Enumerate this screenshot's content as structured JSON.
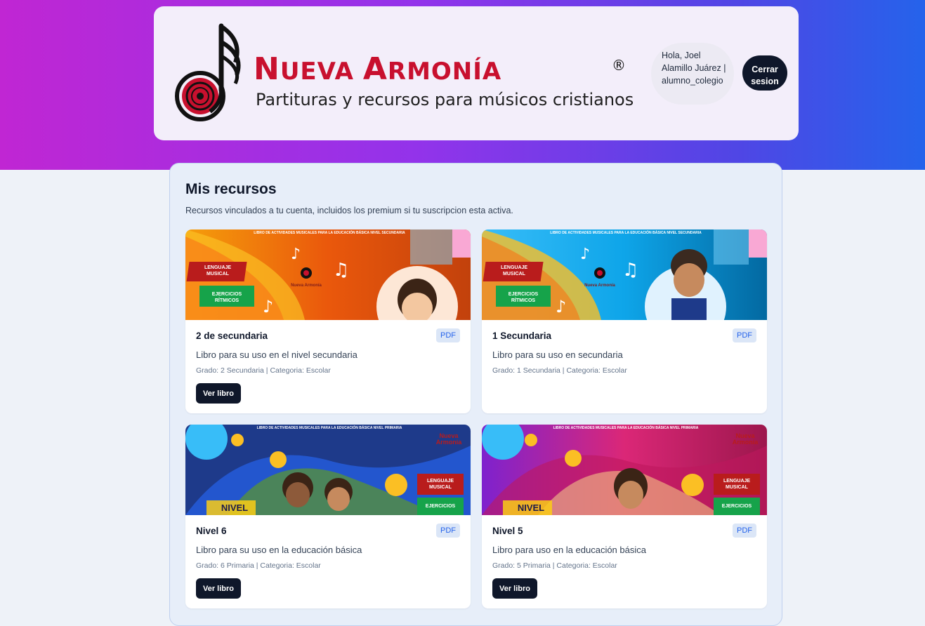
{
  "header": {
    "brand_name_first": "N",
    "brand_name_rest": "UEVA ",
    "brand_name_first2": "A",
    "brand_name_rest2": "RMONÍA",
    "registered_mark": "®",
    "tagline": "Partituras y recursos para músicos cristianos",
    "user_greeting": "Hola, Joel Alamillo Juárez | alumno_colegio",
    "logout_label": "Cerrar sesion"
  },
  "main": {
    "title": "Mis recursos",
    "subtitle": "Recursos vinculados a tu cuenta, incluidos los premium si tu suscripcion esta activa.",
    "cards": [
      {
        "title": "2 de secundaria",
        "badge": "PDF",
        "description": "Libro para su uso en el nivel secundaria",
        "meta": "Grado: 2 Secundaria | Categoria: Escolar",
        "button": "Ver libro",
        "cover_theme": "orange",
        "cover_headline": "LIBRO DE ACTIVIDADES MUSICALES PARA LA EDUCACIÓN BÁSICA NIVEL SECUNDARIA",
        "cover_tag1": "LENGUAJE MUSICAL",
        "cover_tag2": "EJERCICIOS RÍTMICOS",
        "cover_brand": "Nueva Armonía"
      },
      {
        "title": "1 Secundaria",
        "badge": "PDF",
        "description": "Libro para su uso en secundaria",
        "meta": "Grado: 1 Secundaria | Categoria: Escolar",
        "button": "",
        "cover_theme": "blue",
        "cover_headline": "LIBRO DE ACTIVIDADES MUSICALES PARA LA EDUCACIÓN BÁSICA NIVEL SECUNDARIA",
        "cover_tag1": "LENGUAJE MUSICAL",
        "cover_tag2": "EJERCICIOS RÍTMICOS",
        "cover_brand": "Nueva Armonía"
      },
      {
        "title": "Nivel 6",
        "badge": "PDF",
        "description": "Libro para su uso en la educación básica",
        "meta": "Grado: 6 Primaria | Categoria: Escolar",
        "button": "Ver libro",
        "cover_theme": "navy",
        "cover_headline": "LIBRO DE ACTIVIDADES MUSICALES PARA LA EDUCACIÓN BÁSICA NIVEL PRIMARIA",
        "cover_tag1": "LENGUAJE MUSICAL",
        "cover_tag2": "EJERCICIOS",
        "cover_brand": "Nueva Armonia",
        "cover_level": "NIVEL"
      },
      {
        "title": "Nivel 5",
        "badge": "PDF",
        "description": "Libro para uso en la educación básica",
        "meta": "Grado: 5 Primaria | Categoria: Escolar",
        "button": "Ver libro",
        "cover_theme": "magenta",
        "cover_headline": "LIBRO DE ACTIVIDADES MUSICALES PARA LA EDUCACIÓN BÁSICA NIVEL PRIMARIA",
        "cover_tag1": "LENGUAJE MUSICAL",
        "cover_tag2": "EJERCICIOS",
        "cover_brand": "Nueva Armonia",
        "cover_level": "NIVEL"
      }
    ]
  },
  "colors": {
    "brand_red": "#c8102e",
    "dark_button": "#0f172a",
    "badge_bg": "#dbe6f7",
    "badge_text": "#2563eb"
  },
  "icons": {
    "logo": "music-note-disc-icon"
  }
}
